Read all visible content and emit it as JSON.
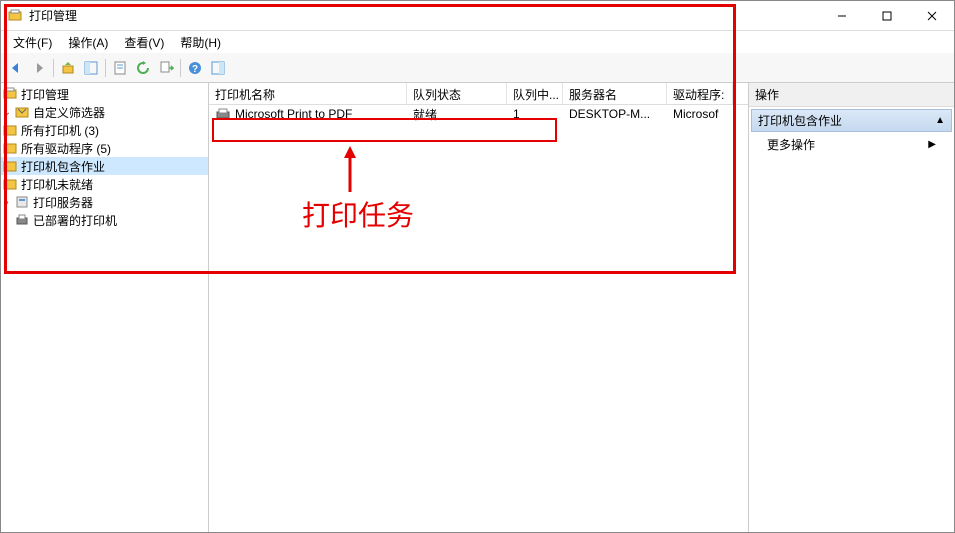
{
  "title": "打印管理",
  "menus": {
    "file": "文件(F)",
    "action": "操作(A)",
    "view": "查看(V)",
    "help": "帮助(H)"
  },
  "tree": {
    "root": "打印管理",
    "custom_filters": "自定义筛选器",
    "all_printers": "所有打印机 (3)",
    "all_drivers": "所有驱动程序 (5)",
    "printers_with_jobs": "打印机包含作业",
    "printers_not_ready": "打印机未就绪",
    "print_servers": "打印服务器",
    "deployed_printers": "已部署的打印机"
  },
  "columns": {
    "name": "打印机名称",
    "status": "队列状态",
    "queue": "队列中...",
    "server": "服务器名",
    "driver": "驱动程序:"
  },
  "printer": {
    "name": "Microsoft Print to PDF",
    "status": "就绪",
    "queue": "1",
    "server": "DESKTOP-M...",
    "driver": "Microsof"
  },
  "actions": {
    "header": "操作",
    "subheader": "打印机包含作业",
    "more": "更多操作"
  },
  "annotation": "打印任务"
}
